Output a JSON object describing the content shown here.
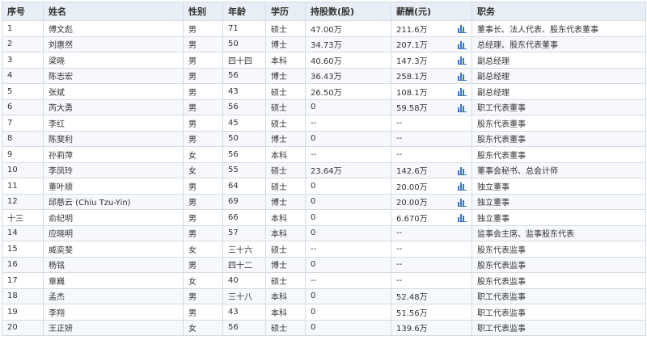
{
  "table": {
    "headers": [
      "序号",
      "姓名",
      "性别",
      "年龄",
      "学历",
      "持股数(股)",
      "薪酬(元)",
      "职务"
    ],
    "rows": [
      {
        "no": "1",
        "name": "傅文彪",
        "gender": "男",
        "age": "71",
        "edu": "硕士",
        "shares": "47.00万",
        "pay": "211.6万",
        "chart": true,
        "title": "董事长、法人代表、股东代表董事"
      },
      {
        "no": "2",
        "name": "刘惠然",
        "gender": "男",
        "age": "50",
        "edu": "博士",
        "shares": "34.73万",
        "pay": "207.1万",
        "chart": true,
        "title": "总经理、股东代表董事"
      },
      {
        "no": "3",
        "name": "梁晓",
        "gender": "男",
        "age": "四十四",
        "edu": "本科",
        "shares": "40.60万",
        "pay": "147.3万",
        "chart": true,
        "title": "副总经理"
      },
      {
        "no": "4",
        "name": "陈志宏",
        "gender": "男",
        "age": "56",
        "edu": "博士",
        "shares": "36.43万",
        "pay": "258.1万",
        "chart": true,
        "title": "副总经理"
      },
      {
        "no": "5",
        "name": "张斌",
        "gender": "男",
        "age": "43",
        "edu": "硕士",
        "shares": "26.50万",
        "pay": "108.1万",
        "chart": true,
        "title": "副总经理"
      },
      {
        "no": "6",
        "name": "芮大勇",
        "gender": "男",
        "age": "56",
        "edu": "硕士",
        "shares": "0",
        "pay": "59.58万",
        "chart": true,
        "title": "职工代表董事"
      },
      {
        "no": "7",
        "name": "李红",
        "gender": "男",
        "age": "45",
        "edu": "硕士",
        "shares": "--",
        "pay": "--",
        "chart": false,
        "title": "股东代表董事"
      },
      {
        "no": "8",
        "name": "陈斐利",
        "gender": "男",
        "age": "50",
        "edu": "博士",
        "shares": "0",
        "pay": "--",
        "chart": false,
        "title": "股东代表董事"
      },
      {
        "no": "9",
        "name": "孙莉萍",
        "gender": "女",
        "age": "56",
        "edu": "本科",
        "shares": "--",
        "pay": "--",
        "chart": false,
        "title": "股东代表董事"
      },
      {
        "no": "10",
        "name": "李凤玲",
        "gender": "女",
        "age": "55",
        "edu": "硕士",
        "shares": "23.64万",
        "pay": "142.6万",
        "chart": true,
        "title": "董事会秘书、总会计师"
      },
      {
        "no": "11",
        "name": "董叶顺",
        "gender": "男",
        "age": "64",
        "edu": "硕士",
        "shares": "0",
        "pay": "20.00万",
        "chart": true,
        "title": "独立董事"
      },
      {
        "no": "12",
        "name": "邱慈云 (Chiu Tzu-Yin)",
        "gender": "男",
        "age": "69",
        "edu": "博士",
        "shares": "0",
        "pay": "20.00万",
        "chart": true,
        "title": "独立董事"
      },
      {
        "no": "十三",
        "name": "俞纪明",
        "gender": "男",
        "age": "66",
        "edu": "本科",
        "shares": "0",
        "pay": "6.670万",
        "chart": true,
        "title": "独立董事"
      },
      {
        "no": "14",
        "name": "应晓明",
        "gender": "男",
        "age": "57",
        "edu": "本科",
        "shares": "0",
        "pay": "--",
        "chart": false,
        "title": "监事会主席、监事股东代表"
      },
      {
        "no": "15",
        "name": "威奕斐",
        "gender": "女",
        "age": "三十六",
        "edu": "硕士",
        "shares": "--",
        "pay": "--",
        "chart": false,
        "title": "股东代表监事"
      },
      {
        "no": "16",
        "name": "杨铭",
        "gender": "男",
        "age": "四十二",
        "edu": "博士",
        "shares": "0",
        "pay": "--",
        "chart": false,
        "title": "股东代表监事"
      },
      {
        "no": "17",
        "name": "章巍",
        "gender": "女",
        "age": "40",
        "edu": "硕士",
        "shares": "--",
        "pay": "--",
        "chart": false,
        "title": "股东代表监事"
      },
      {
        "no": "18",
        "name": "孟杰",
        "gender": "男",
        "age": "三十八",
        "edu": "本科",
        "shares": "0",
        "pay": "52.48万",
        "chart": false,
        "title": "职工代表监事"
      },
      {
        "no": "19",
        "name": "李翔",
        "gender": "男",
        "age": "43",
        "edu": "本科",
        "shares": "0",
        "pay": "51.56万",
        "chart": false,
        "title": "职工代表监事"
      },
      {
        "no": "20",
        "name": "王正妍",
        "gender": "女",
        "age": "56",
        "edu": "硕士",
        "shares": "0",
        "pay": "139.6万",
        "chart": false,
        "title": "职工代表监事"
      }
    ]
  },
  "icons": {
    "income_chart": "bar-chart-icon"
  },
  "colors": {
    "header_bg": "#e8eef5",
    "border": "#d3dbe3",
    "icon": "#3a74c4"
  }
}
